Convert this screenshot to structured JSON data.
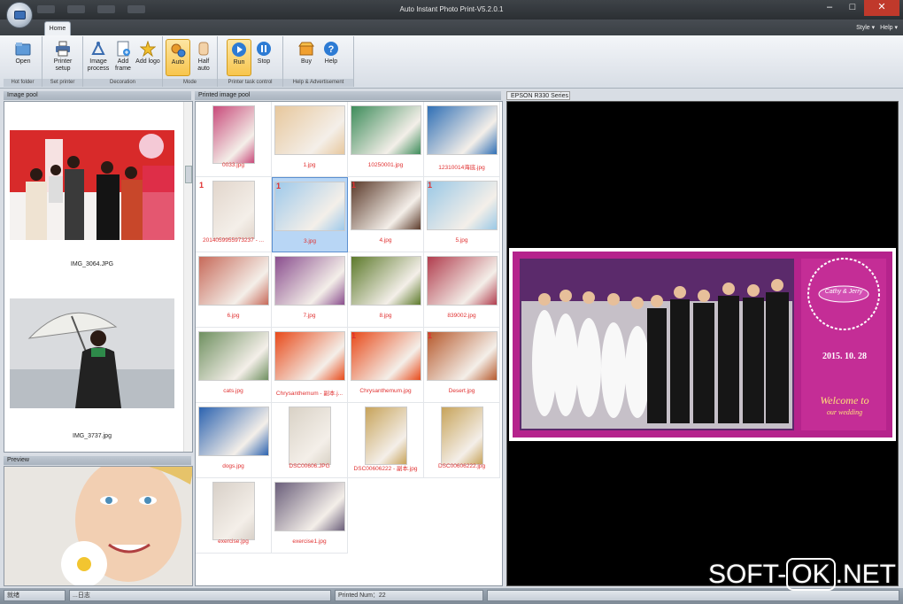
{
  "window": {
    "title": "Auto Instant Photo Print-V5.2.0.1"
  },
  "tabs": {
    "home": "Home",
    "style": "Style",
    "help": "Help"
  },
  "ribbon": {
    "groups": {
      "hot_folder": "Hot folder",
      "set_printer": "Set printer",
      "decoration": "Decoration",
      "mode": "Mode",
      "printer_task": "Printer task control",
      "help_ad": "Help & Advertisement"
    },
    "buttons": {
      "open": "Open",
      "printer_setup": "Printer setup",
      "image_process": "Image process",
      "add_frame": "Add frame",
      "add_logo": "Add logo",
      "auto": "Auto",
      "half_auto": "Half auto",
      "run": "Run",
      "stop": "Stop",
      "buy": "Buy",
      "help": "Help"
    }
  },
  "image_pool": {
    "title": "Image pool",
    "items": [
      {
        "caption": "IMG_3064.JPG"
      },
      {
        "caption": "IMG_3737.jpg"
      }
    ]
  },
  "preview": {
    "title": "Preview"
  },
  "printed_pool": {
    "title": "Printed image pool",
    "items": [
      {
        "caption": "0033.jpg",
        "num": ""
      },
      {
        "caption": "1.jpg",
        "num": ""
      },
      {
        "caption": "10250001.jpg",
        "num": ""
      },
      {
        "caption": "12310014海底.jpg",
        "num": ""
      },
      {
        "caption": "2014059955973237 - ...",
        "num": "1"
      },
      {
        "caption": "3.jpg",
        "num": "1"
      },
      {
        "caption": "4.jpg",
        "num": "1"
      },
      {
        "caption": "5.jpg",
        "num": "1"
      },
      {
        "caption": "6.jpg",
        "num": ""
      },
      {
        "caption": "7.jpg",
        "num": ""
      },
      {
        "caption": "8.jpg",
        "num": ""
      },
      {
        "caption": "839002.jpg",
        "num": ""
      },
      {
        "caption": "cats.jpg",
        "num": ""
      },
      {
        "caption": "Chrysanthemum - 副本.j...",
        "num": ""
      },
      {
        "caption": "Chrysanthemum.jpg",
        "num": "1"
      },
      {
        "caption": "Desert.jpg",
        "num": "1"
      },
      {
        "caption": "dogs.jpg",
        "num": ""
      },
      {
        "caption": "DSC00606.JPG",
        "num": ""
      },
      {
        "caption": "DSC00606222 - 副本.jpg",
        "num": ""
      },
      {
        "caption": "DSC00606222.jpg",
        "num": ""
      },
      {
        "caption": "exercise.jpg",
        "num": ""
      },
      {
        "caption": "exercise1.jpg",
        "num": ""
      }
    ]
  },
  "printer_panel": {
    "title": "EPSON R330 Series",
    "card_names": "Cathy & Jerry",
    "card_date": "2015. 10. 28",
    "card_welcome": "Welcome to",
    "card_sub": "our wedding"
  },
  "statusbar": {
    "s1": "就绪",
    "s2": "...日志",
    "s3": "Printed Num：22"
  },
  "watermark": {
    "left": "SOFT-",
    "box": "OK",
    "right": ".NET"
  }
}
